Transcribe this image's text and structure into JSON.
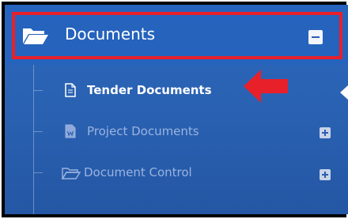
{
  "sidebar": {
    "section_title": "Documents",
    "items": [
      {
        "label": "Tender Documents",
        "state": "active",
        "icon": "file-icon"
      },
      {
        "label": "Project Documents",
        "state": "collapsed",
        "icon": "word-file-icon"
      },
      {
        "label": "Document Control",
        "state": "collapsed",
        "icon": "folder-open-icon"
      }
    ]
  },
  "colors": {
    "sidebar_bg": "#2563bd",
    "highlight": "#e8202a",
    "arrow": "#e8202a",
    "active_text": "#ffffff",
    "muted_text": "#9bb3e0"
  }
}
